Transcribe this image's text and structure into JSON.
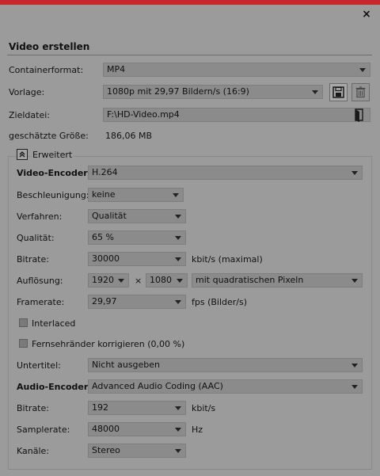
{
  "window": {
    "close_symbol": "×"
  },
  "section_title": "Video erstellen",
  "container": {
    "label": "Containerformat:",
    "value": "MP4"
  },
  "preset": {
    "label": "Vorlage:",
    "value": "1080p mit 29,97 Bildern/s (16:9)",
    "save_icon": "floppy-disk-icon",
    "delete_icon": "trash-icon"
  },
  "target": {
    "label": "Zieldatei:",
    "value": "F:\\HD-Video.mp4",
    "browse_icon": "folder-icon"
  },
  "size": {
    "label": "geschätzte Größe:",
    "value": "186,06 MB"
  },
  "advanced": {
    "label": "Erweitert",
    "icon": "collapse-up-icon"
  },
  "video_encoder": {
    "label": "Video-Encoder:",
    "value": "H.264"
  },
  "acceleration": {
    "label": "Beschleunigung:",
    "value": "keine"
  },
  "method": {
    "label": "Verfahren:",
    "value": "Qualität"
  },
  "quality": {
    "label": "Qualität:",
    "value": "65 %"
  },
  "video_bitrate": {
    "label": "Bitrate:",
    "value": "30000",
    "unit": "kbit/s (maximal)"
  },
  "resolution": {
    "label": "Auflösung:",
    "width": "1920",
    "times": "×",
    "height": "1080",
    "pixel": "mit quadratischen Pixeln"
  },
  "framerate": {
    "label": "Framerate:",
    "value": "29,97",
    "unit": "fps (Bilder/s)"
  },
  "interlaced": {
    "label": "Interlaced",
    "checked": false
  },
  "tv_border": {
    "label": "Fernsehränder korrigieren (0,00 %)",
    "checked": false
  },
  "subtitle": {
    "label": "Untertitel:",
    "value": "Nicht ausgeben"
  },
  "audio_encoder": {
    "label": "Audio-Encoder:",
    "value": "Advanced Audio Coding (AAC)"
  },
  "audio_bitrate": {
    "label": "Bitrate:",
    "value": "192",
    "unit": "kbit/s"
  },
  "samplerate": {
    "label": "Samplerate:",
    "value": "48000",
    "unit": "Hz"
  },
  "channels": {
    "label": "Kanäle:",
    "value": "Stereo"
  }
}
